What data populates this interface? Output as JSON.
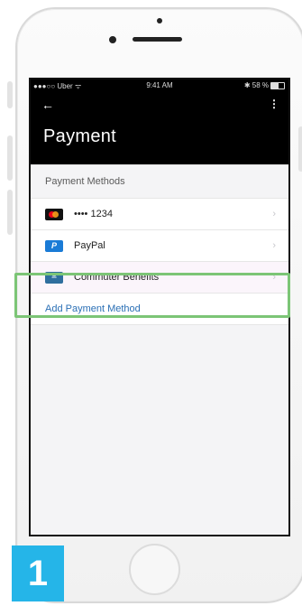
{
  "status_bar": {
    "carrier": "●●●○○ Uber ᯤ",
    "time": "9:41 AM",
    "battery": "✱ 58 %"
  },
  "header": {
    "back_icon": "←",
    "menu_icon": "⋮",
    "title": "Payment"
  },
  "section": {
    "title": "Payment Methods"
  },
  "methods": [
    {
      "label": "•••• 1234",
      "icon": "mastercard-icon"
    },
    {
      "label": "PayPal",
      "icon": "paypal-icon"
    },
    {
      "label": "Commuter Benefits",
      "icon": "commuter-benefits-icon"
    }
  ],
  "add_method_label": "Add Payment Method",
  "chevron": "›",
  "step_number": "1",
  "colors": {
    "accent_link": "#2a6fb5",
    "callout_border": "#7cc576",
    "step_badge": "#25b5e8"
  }
}
